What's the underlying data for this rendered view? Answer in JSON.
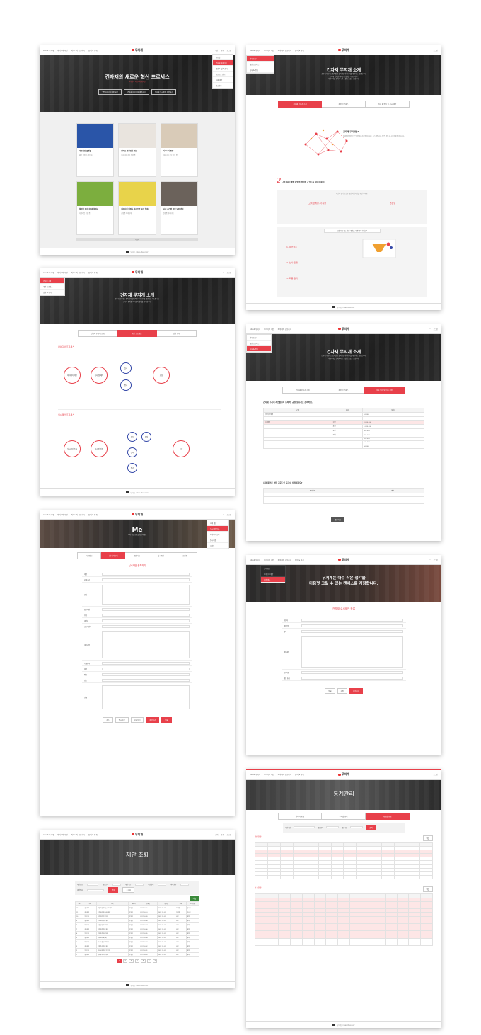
{
  "brand": {
    "logo": "무지개"
  },
  "topnav": {
    "items": [
      "About 무지개",
      "아이디어 제안",
      "아이디어 공모하기",
      "참여 & 통계"
    ],
    "right": [
      "제안",
      "검색",
      "통계",
      "로그인"
    ]
  },
  "colors": {
    "accent": "#e8404a",
    "blue": "#3448a8",
    "dark": "#2b2b2b"
  },
  "p1": {
    "hero_title": "건자재의 새로운 혁신 프로세스",
    "hero_sub": "#무지개 아이디어 게시판",
    "buttons": [
      "그룹 아이디어 제안하기",
      "건자재 아이디어 제안하기",
      "건자재 실시제안 제안하기"
    ],
    "menu": [
      "자료실",
      "건자재 아이디어",
      "제안 & 실적 관리",
      "다운로드 관리",
      "나의 제안",
      "로그아웃"
    ],
    "cards": [
      {
        "title": "재료절감 플랜물",
        "sub": "매우 희망적 제안 성공"
      },
      {
        "title": "알까요 건강검진 제도",
        "sub": "아이디어 공모 진행 중"
      },
      {
        "title": "아이디어 통합",
        "sub": "아이디어 공모 진행 중"
      },
      {
        "title": "협력형 아이디어의 협력사",
        "sub": "지원사업 진행 중"
      },
      {
        "title": "아이디어 협력사 라이브로 혁신 할까?",
        "sub": "진행중 아이디어"
      },
      {
        "title": "사내 시간별 통합 요청 관리",
        "sub": "진행중 아이디어"
      }
    ],
    "more": "더보기",
    "footer": "무지개 · ideas.Idea.re.kr"
  },
  "p2": {
    "hero_title": "건자재 무지개 소개",
    "hero_lines": [
      "건자재 무지개는 임직원의 창의적인 아이디어를 제안하는 제도입니다.",
      "건자재 임직원 여러분의 참여를 기다립니다.",
      "아이디어를 등록하시면 소정의 포상을 드립니다."
    ],
    "tabs": [
      "건자재 무지개 소개",
      "제안 프로세스",
      "심사 & 평가 및 실시 제안"
    ],
    "section1_title": "건자재 무지개란?",
    "section1_text": "창의적인 생각으로 임직원이 가치를 창출하는 시스템입니다. 작은 생각 하나가 변화를 만듭니다.",
    "section2_title": "나의 일에 대해 어떻게 생각하고 있는지 알려주세요?",
    "section2_sub": "자신의 생각과 업무 개선 아이디어를 제안 하세요.",
    "roles": [
      "고객 관계형, 기획형",
      "현장형"
    ],
    "section3_title": "그럼 무지개는 어떤 제안을 해결해야 하나요?",
    "steps": [
      "1. 제안접수",
      "2. 심사 진행",
      "3. 최종 결과"
    ],
    "footer": "무지개 · ideas.Idea.re.kr"
  },
  "p3": {
    "hero_title": "건자재 무지개 소개",
    "tabs": [
      "건자재 무지개 소개",
      "제안 프로세스",
      "심사 평가"
    ],
    "s1_title": "아이디어 프로세스",
    "s1_nodes": [
      "아이디어 제안",
      "심사 및 채택",
      "실시",
      "평가",
      "포상"
    ],
    "s2_title": "실시제안 프로세스",
    "s2_nodes": [
      "실시제안 등록",
      "부서장 검토",
      "검토",
      "결정",
      "실시",
      "평가",
      "포상"
    ],
    "menu": [
      "건자재 소개",
      "제안 프로세스",
      "심사 & 평가"
    ]
  },
  "p4": {
    "hero_title": "건자재 무지개 소개",
    "tabs": [
      "건자재 무지개 소개",
      "제안 프로세스",
      "심사 평가 및 실시 제안"
    ],
    "s1_title": "건자재 무지개 제안활동에 등록하, 공정 실시자로 참여하면,",
    "table_head": [
      "구분",
      "등급",
      "포상금"
    ],
    "table_rows": [
      [
        "아이디어 채택",
        "",
        "10,000"
      ],
      [
        "",
        "",
        ""
      ],
      [
        "실시제안",
        "금상",
        "2,000,000"
      ],
      [
        "",
        "은상",
        "1,000,000"
      ],
      [
        "",
        "동상",
        "500,000"
      ],
      [
        "",
        "장려",
        "300,000"
      ],
      [
        "",
        "",
        "200,000"
      ],
      [
        "",
        "",
        "100,000"
      ],
      [
        "",
        "",
        "50,000"
      ]
    ],
    "s2_title": "나의 제안은 어떤 기준으로 등급이 산정될까요?",
    "s2_head": [
      "평가항목",
      "배점"
    ],
    "confirm": "제안하기"
  },
  "p5": {
    "hero_title": "Me",
    "hero_sub": "나의 제안 현황을 확인하세요",
    "tabs": [
      "기본정보",
      "나의 아이디어",
      "제안하기",
      "실시제안",
      "포인트"
    ],
    "title": "실시제안 등록하기",
    "labels": [
      "제목",
      "카테고리",
      "현상",
      "개선내용",
      "첨부파일",
      "부서",
      "제안자",
      "공동제안자",
      "기대효과",
      "비용",
      "평가",
      "검토",
      "결재"
    ],
    "buttons": [
      "취소",
      "임시저장",
      "미리보기",
      "제안하기",
      "목록"
    ],
    "menu": [
      "나의 제안",
      "실시제안 등록",
      "아이디어 등록",
      "임시저장",
      "포인트"
    ]
  },
  "p6": {
    "hero_title1": "무지개는 아주 작은 생각을",
    "hero_title2": "마음껏 그릴 수 있는 캔버스를 지향합니다.",
    "form_title": "건자재 실시제안 등록",
    "labels": [
      "작성자",
      "제안분야",
      "제목",
      "제안내용",
      "첨부파일",
      "개선 효과"
    ],
    "buttons": [
      "목록",
      "저장",
      "제안하기"
    ],
    "menu": [
      "실시제안",
      "아이디어 제안",
      "제안 결과"
    ]
  },
  "p7": {
    "hero_title": "제안 조회",
    "search_labels": [
      "제안번호",
      "제안분야",
      "제안구분",
      "제안상태",
      "처리결과",
      "제안일자"
    ],
    "search_btn": "검색",
    "reset_btn": "초기화",
    "excel": "엑셀",
    "columns": [
      "No.",
      "구분",
      "제목",
      "제안자",
      "등록일",
      "심사일",
      "상태",
      "진행상황"
    ],
    "rows": [
      [
        "12",
        "실시제안",
        "작업 효율 개선을 위한 제안",
        "홍길동",
        "2017.10.11",
        "2017.11.01",
        "진행중",
        "심사중"
      ],
      [
        "11",
        "실시제안",
        "공정 관리 프로세스 제안",
        "홍길동",
        "2017.10.10",
        "2017.11.01",
        "진행중",
        "심사중"
      ],
      [
        "10",
        "아이디어",
        "원가 절감 아이디어",
        "홍길동",
        "2017.10.09",
        "2017.11.01",
        "완료",
        "채택"
      ],
      [
        "9",
        "실시제안",
        "안전 관리 개선 제안",
        "홍길동",
        "2017.10.08",
        "2017.11.01",
        "완료",
        "채택"
      ],
      [
        "8",
        "아이디어",
        "품질 향상 아이디어",
        "홍길동",
        "2017.10.07",
        "2017.11.01",
        "완료",
        "채택"
      ],
      [
        "7",
        "실시제안",
        "현장 환경 개선 제안",
        "홍길동",
        "2017.10.06",
        "2017.11.01",
        "완료",
        "채택"
      ],
      [
        "6",
        "아이디어",
        "업무 프로세스 개선",
        "홍길동",
        "2017.10.05",
        "2017.11.01",
        "완료",
        "채택"
      ],
      [
        "5",
        "실시제안",
        "자재 관리 효율화",
        "홍길동",
        "2017.10.04",
        "2017.11.01",
        "완료",
        "채택"
      ],
      [
        "4",
        "아이디어",
        "에너지 절감 아이디어",
        "홍길동",
        "2017.10.03",
        "2017.11.01",
        "완료",
        "채택"
      ],
      [
        "3",
        "실시제안",
        "물류 동선 개선 제안",
        "홍길동",
        "2017.10.02",
        "2017.11.01",
        "완료",
        "채택"
      ],
      [
        "2",
        "아이디어",
        "사내 소통 개선 아이디어",
        "홍길동",
        "2017.10.01",
        "2017.11.01",
        "완료",
        "채택"
      ],
      [
        "1",
        "실시제안",
        "설비 유지보수 개선",
        "홍길동",
        "2017.09.30",
        "2017.11.01",
        "완료",
        "채택"
      ]
    ],
    "pages": [
      "1",
      "2",
      "3",
      "4",
      "5",
      "6",
      "7"
    ],
    "footer": "무지개 · ideas.Idea.re.kr"
  },
  "p8": {
    "hero_title": "통계관리",
    "tabs": [
      "관리자 통계",
      "부서별 통계",
      "개인별 통계"
    ],
    "filter_labels": [
      "제안기간",
      "제안분야",
      "제안구분",
      "검색"
    ],
    "table1_title": "제안현황",
    "table2_title": "실시현황",
    "excel": "엑셀",
    "footer": "무지개 · ideas.Idea.re.kr"
  }
}
